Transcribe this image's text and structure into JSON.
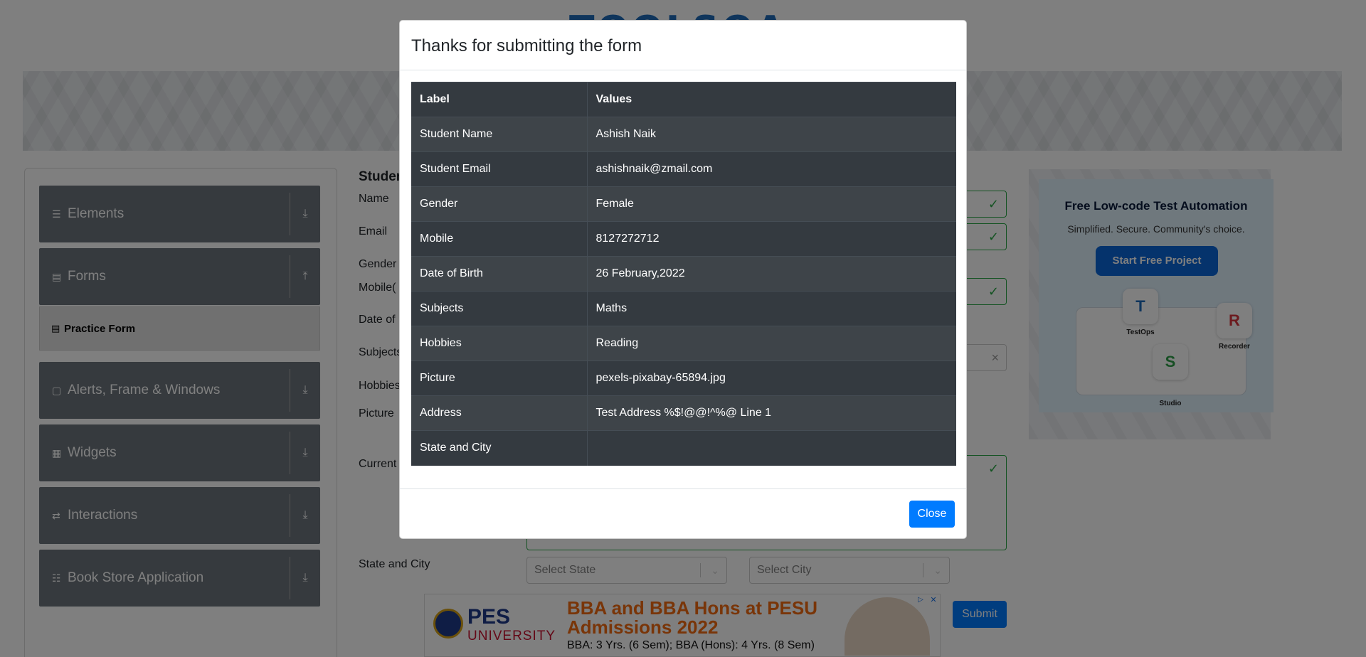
{
  "header": {
    "logo_text": "TOOLSQA"
  },
  "sidebar": {
    "groups": [
      {
        "label": "Elements",
        "icon": "list-icon",
        "arrow": "download-arrow-icon"
      },
      {
        "label": "Forms",
        "icon": "document-icon",
        "arrow": "upload-arrow-icon"
      },
      {
        "label": "Alerts, Frame & Windows",
        "icon": "window-icon",
        "arrow": "download-arrow-icon"
      },
      {
        "label": "Widgets",
        "icon": "grid-icon",
        "arrow": "download-arrow-icon"
      },
      {
        "label": "Interactions",
        "icon": "interactions-icon",
        "arrow": "download-arrow-icon"
      },
      {
        "label": "Book Store Application",
        "icon": "books-icon",
        "arrow": "download-arrow-icon"
      }
    ],
    "active_item": {
      "label": "Practice Form",
      "icon": "form-icon"
    }
  },
  "form": {
    "title": "Studen",
    "labels": {
      "name": "Name",
      "email": "Email",
      "gender": "Gender",
      "mobile": "Mobile(",
      "dob": "Date of",
      "subjects": "Subjects",
      "hobbies": "Hobbies",
      "picture": "Picture",
      "address": "Current",
      "state_city": "State and City"
    },
    "state_placeholder": "Select State",
    "city_placeholder": "Select City",
    "submit_label": "Submit"
  },
  "side_ad": {
    "title": "Free Low-code Test Automation",
    "subtitle": "Simplified. Secure. Community's choice.",
    "button": "Start Free Project",
    "apps": [
      {
        "name": "TestOps",
        "letter": "T"
      },
      {
        "name": "Recorder",
        "letter": "R"
      },
      {
        "name": "Studio",
        "letter": "S"
      }
    ]
  },
  "bottom_ad": {
    "brand_line1": "PES",
    "brand_line2": "UNIVERSITY",
    "headline": "BBA and BBA Hons at PESU Admissions 2022",
    "subline": "BBA: 3 Yrs. (6 Sem); BBA (Hons): 4 Yrs. (8 Sem)"
  },
  "modal": {
    "title": "Thanks for submitting the form",
    "table": {
      "headers": [
        "Label",
        "Values"
      ],
      "rows": [
        {
          "label": "Student Name",
          "value": "Ashish Naik"
        },
        {
          "label": "Student Email",
          "value": "ashishnaik@zmail.com"
        },
        {
          "label": "Gender",
          "value": "Female"
        },
        {
          "label": "Mobile",
          "value": "8127272712"
        },
        {
          "label": "Date of Birth",
          "value": "26 February,2022"
        },
        {
          "label": "Subjects",
          "value": "Maths"
        },
        {
          "label": "Hobbies",
          "value": "Reading"
        },
        {
          "label": "Picture",
          "value": "pexels-pixabay-65894.jpg"
        },
        {
          "label": "Address",
          "value": "Test Address %$!@@!^%@ Line 1"
        },
        {
          "label": "State and City",
          "value": ""
        }
      ]
    },
    "close_label": "Close"
  },
  "colors": {
    "overlay": "rgba(0,0,0,0.5)",
    "primary": "#007bff",
    "table_dark": "#343a40",
    "sidebar_group": "#6c757d",
    "valid_green": "#28a745"
  }
}
